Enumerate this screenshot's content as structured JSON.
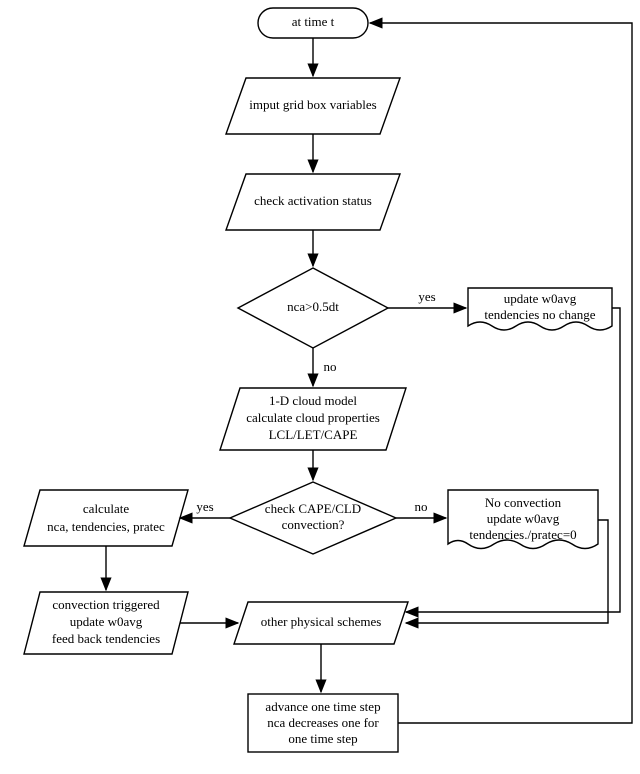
{
  "nodes": {
    "start": {
      "text": "at time t"
    },
    "input": {
      "l1": "imput grid box variables"
    },
    "check_act": {
      "l1": "check activation status"
    },
    "decision_nca": {
      "text": "nca>0.5dt"
    },
    "update_w0avg": {
      "l1": "update w0avg",
      "l2": "tendencies no change"
    },
    "cloud_model": {
      "l1": "1-D cloud model",
      "l2": "calculate cloud properties",
      "l3": "LCL/LET/CAPE"
    },
    "decision_cape": {
      "l1": "check CAPE/CLD",
      "l2": "convection?"
    },
    "calc_nca": {
      "l1": "calculate",
      "l2": "nca, tendencies, pratec"
    },
    "no_conv": {
      "l1": "No convection",
      "l2": "update w0avg",
      "l3": "tendencies./pratec=0"
    },
    "triggered": {
      "l1": "convection triggered",
      "l2": "update w0avg",
      "l3": "feed back tendencies"
    },
    "other": {
      "l1": "other physical schemes"
    },
    "advance": {
      "l1": "advance one time step",
      "l2": "nca decreases one for",
      "l3": "one time step"
    }
  },
  "labels": {
    "yes": "yes",
    "no": "no"
  }
}
